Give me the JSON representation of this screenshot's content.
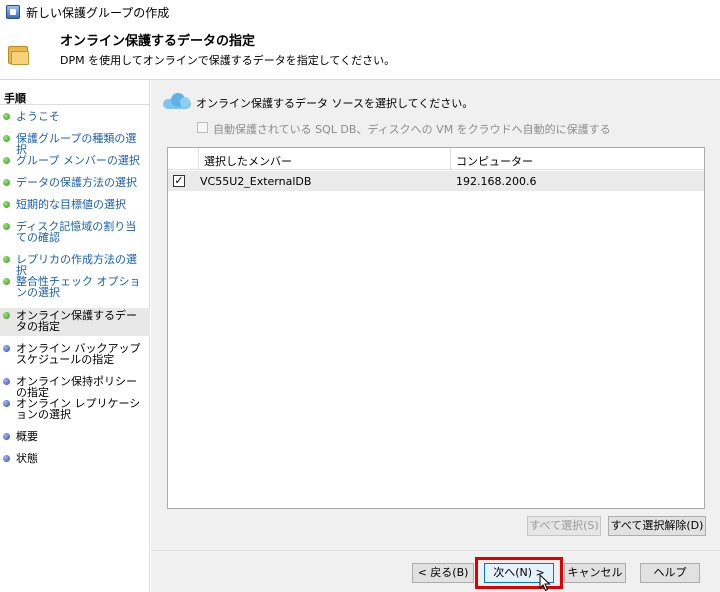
{
  "window": {
    "title": "新しい保護グループの作成"
  },
  "header": {
    "title": "オンライン保護するデータの指定",
    "subtitle": "DPM を使用してオンラインで保護するデータを指定してください。"
  },
  "sidebar": {
    "heading": "手順",
    "items": [
      {
        "label": "ようこそ",
        "state": "done"
      },
      {
        "label": "保護グループの種類の選択",
        "state": "done"
      },
      {
        "label": "グループ メンバーの選択",
        "state": "done"
      },
      {
        "label": "データの保護方法の選択",
        "state": "done"
      },
      {
        "label": "短期的な目標値の選択",
        "state": "done"
      },
      {
        "label": "ディスク記憶域の割り当ての確認",
        "state": "done"
      },
      {
        "label": "レプリカの作成方法の選択",
        "state": "done"
      },
      {
        "label": "整合性チェック オプションの選択",
        "state": "done"
      },
      {
        "label": "オンライン保護するデータの指定",
        "state": "current"
      },
      {
        "label": "オンライン バックアップ スケジュールの指定",
        "state": "todo"
      },
      {
        "label": "オンライン保持ポリシーの指定",
        "state": "todo"
      },
      {
        "label": "オンライン レプリケーションの選択",
        "state": "todo"
      },
      {
        "label": "概要",
        "state": "todo"
      },
      {
        "label": "状態",
        "state": "todo"
      }
    ]
  },
  "main": {
    "instruction": "オンライン保護するデータ ソースを選択してください。",
    "auto_protect_label": "自動保護されている SQL DB、ディスクへの VM をクラウドへ自動的に保護する",
    "auto_protect_checked": false,
    "table": {
      "columns": [
        "選択したメンバー",
        "コンピューター"
      ],
      "rows": [
        {
          "checked": true,
          "member": "VC55U2_ExternalDB",
          "computer": "192.168.200.6"
        }
      ]
    },
    "select_all_label": "すべて選択(S)",
    "deselect_all_label": "すべて選択解除(D)"
  },
  "footer": {
    "back_label": "< 戻る(B)",
    "next_label": "次へ(N) >",
    "cancel_label": "キャンセル",
    "help_label": "ヘルプ"
  },
  "icons": {
    "app": "app-icon",
    "header": "folder-icon",
    "cloud": "cloud-icon",
    "check": "✓"
  },
  "colors": {
    "done_dot": "#2f9a1b",
    "todo_dot": "#2b45b6",
    "done_label": "#1a5fb4",
    "highlight": "#e00000"
  }
}
